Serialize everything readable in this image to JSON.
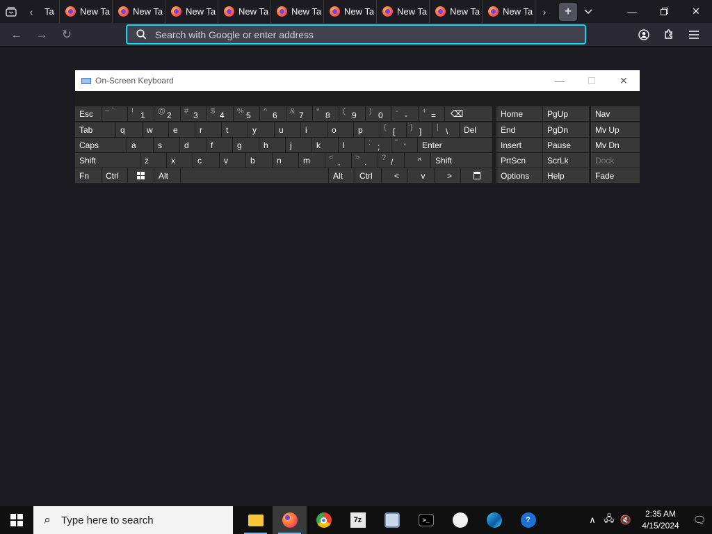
{
  "browser": {
    "tabs": [
      {
        "label": "Ta",
        "partial": true
      },
      {
        "label": "New Ta"
      },
      {
        "label": "New Ta"
      },
      {
        "label": "New Ta"
      },
      {
        "label": "New Ta"
      },
      {
        "label": "New Ta"
      },
      {
        "label": "New Ta"
      },
      {
        "label": "New Ta"
      },
      {
        "label": "New Ta"
      },
      {
        "label": "New Ta"
      }
    ],
    "url_placeholder": "Search with Google or enter address",
    "accent_color": "#00ddff"
  },
  "osk": {
    "title": "On-Screen Keyboard",
    "keys": {
      "esc": "Esc",
      "tilde_sym": "~ `",
      "n1_sym": "!",
      "n1": "1",
      "n2_sym": "@",
      "n2": "2",
      "n3_sym": "#",
      "n3": "3",
      "n4_sym": "$",
      "n4": "4",
      "n5_sym": "%",
      "n5": "5",
      "n6_sym": "^",
      "n6": "6",
      "n7_sym": "&",
      "n7": "7",
      "n8_sym": "*",
      "n8": "8",
      "n9_sym": "(",
      "n9": "9",
      "n0_sym": ")",
      "n0": "0",
      "minus_sym": "-",
      "minus": "-",
      "plus_sym": "+",
      "equals": "=",
      "backspace": "⌫",
      "tab": "Tab",
      "q": "q",
      "w": "w",
      "e": "e",
      "r": "r",
      "t": "t",
      "y": "y",
      "u": "u",
      "i": "i",
      "o": "o",
      "p": "p",
      "lbrace_sym": "{",
      "lbracket": "[",
      "rbrace_sym": "}",
      "rbracket": "]",
      "pipe_sym": "|",
      "backslash": "\\",
      "del": "Del",
      "caps": "Caps",
      "a": "a",
      "s": "s",
      "d": "d",
      "f": "f",
      "g": "g",
      "h": "h",
      "j": "j",
      "k": "k",
      "l": "l",
      "colon_sym": ":",
      "semicolon": ";",
      "quote_sym": "\"",
      "apos": "'",
      "enter": "Enter",
      "shift": "Shift",
      "z": "z",
      "x": "x",
      "c": "c",
      "v": "v",
      "b": "b",
      "n": "n",
      "m": "m",
      "lt_sym": "<",
      "comma": ",",
      "gt_sym": ">",
      "period": ".",
      "qmark_sym": "?",
      "slash": "/",
      "up": "^",
      "rshift": "Shift",
      "fn": "Fn",
      "ctrl": "Ctrl",
      "alt": "Alt",
      "ralt": "Alt",
      "rctrl": "Ctrl",
      "left": "<",
      "down": "v",
      "right": ">",
      "home": "Home",
      "pgup": "PgUp",
      "nav": "Nav",
      "end": "End",
      "pgdn": "PgDn",
      "mvup": "Mv Up",
      "insert": "Insert",
      "pause": "Pause",
      "mvdn": "Mv Dn",
      "prtscn": "PrtScn",
      "scrlk": "ScrLk",
      "dock": "Dock",
      "options": "Options",
      "help": "Help",
      "fade": "Fade"
    }
  },
  "taskbar": {
    "search_placeholder": "Type here to search",
    "apps": [
      "file-explorer",
      "firefox",
      "chrome",
      "7zip",
      "remote-desktop",
      "terminal",
      "paint",
      "edge",
      "help"
    ],
    "time": "2:35 AM",
    "date": "4/15/2024"
  }
}
